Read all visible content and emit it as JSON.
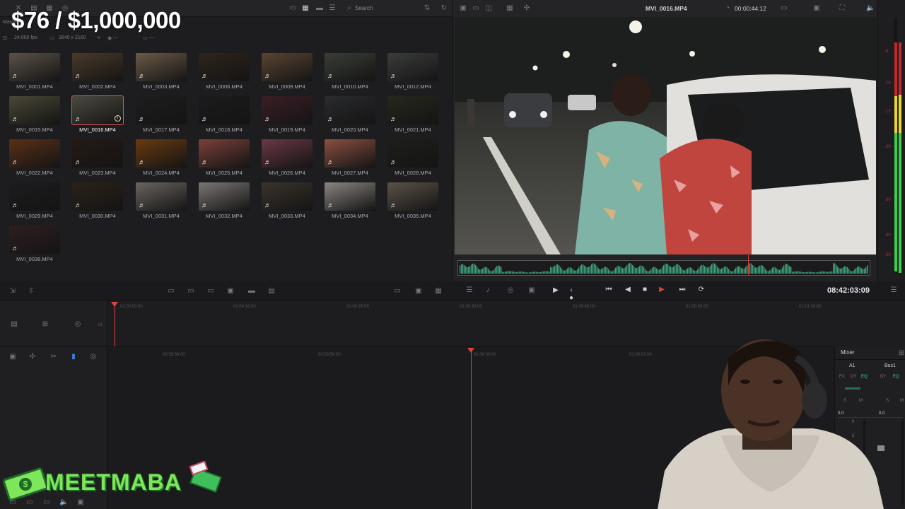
{
  "overlay": {
    "title": "$76 / $1,000,000"
  },
  "media_pool": {
    "header": "Master",
    "search_placeholder": "Search",
    "info": {
      "fps": "24.000 fps",
      "resolution": "3840 x 2160"
    },
    "clips": [
      {
        "name": "MVI_0001.MP4",
        "tone": "#5a5248"
      },
      {
        "name": "MVI_0002.MP4",
        "tone": "#4a3a2a"
      },
      {
        "name": "MVI_0003.MP4",
        "tone": "#6b5a48"
      },
      {
        "name": "MVI_0006.MP4",
        "tone": "#2e241c"
      },
      {
        "name": "MVI_0009.MP4",
        "tone": "#5a4430"
      },
      {
        "name": "MVI_0010.MP4",
        "tone": "#3a3e36"
      },
      {
        "name": "MVI_0012.MP4",
        "tone": "#3a3d3a"
      },
      {
        "name": "MVI_0015.MP4",
        "tone": "#4a4836"
      },
      {
        "name": "MVI_0016.MP4",
        "tone": "#4b4a40",
        "selected": true
      },
      {
        "name": "MVI_0017.MP4",
        "tone": "#1d1d1f"
      },
      {
        "name": "MVI_0018.MP4",
        "tone": "#1b1b1d"
      },
      {
        "name": "MVI_0019.MP4",
        "tone": "#3a1e26"
      },
      {
        "name": "MVI_0020.MP4",
        "tone": "#2a2b2d"
      },
      {
        "name": "MVI_0021.MP4",
        "tone": "#25281c"
      },
      {
        "name": "MVI_0022.MP4",
        "tone": "#5a3018"
      },
      {
        "name": "MVI_0023.MP4",
        "tone": "#251a14"
      },
      {
        "name": "MVI_0024.MP4",
        "tone": "#6a3a10"
      },
      {
        "name": "MVI_0025.MP4",
        "tone": "#7a4038"
      },
      {
        "name": "MVI_0026.MP4",
        "tone": "#6a3844"
      },
      {
        "name": "MVI_0027.MP4",
        "tone": "#8a5040"
      },
      {
        "name": "MVI_0028.MP4",
        "tone": "#1e1e1a"
      },
      {
        "name": "MVI_0029.MP4",
        "tone": "#1c1c1e"
      },
      {
        "name": "MVI_0030.MP4",
        "tone": "#2a2218"
      },
      {
        "name": "MVI_0031.MP4",
        "tone": "#6a6560"
      },
      {
        "name": "MVI_0032.MP4",
        "tone": "#7a7674"
      },
      {
        "name": "MVI_0033.MP4",
        "tone": "#3a342c"
      },
      {
        "name": "MVI_0034.MP4",
        "tone": "#8a8580"
      },
      {
        "name": "MVI_0035.MP4",
        "tone": "#5a5248"
      },
      {
        "name": "MVI_0036.MP4",
        "tone": "#2e1e20"
      }
    ]
  },
  "viewer": {
    "clip_name": "MVI_0016.MP4",
    "duration": "00:00:44:12",
    "timecode": "08:42:03:09"
  },
  "meter": {
    "labels": [
      "-5",
      "-10",
      "-15",
      "-20",
      "-30",
      "-40",
      "-50"
    ]
  },
  "mini_timeline": {
    "ruler": [
      "01:00:00:00",
      "01:00:16:00",
      "01:00:26:09",
      "01:00:30:00",
      "01:00:45:00",
      "01:00:50:00",
      "01:01:00:00"
    ],
    "track": "V1"
  },
  "main_timeline": {
    "ruler": [
      "00:59:56:00",
      "00:59:58:00",
      "01:00:00:00",
      "01:00:02:00"
    ]
  },
  "mixer": {
    "title": "Mixer",
    "channels": [
      {
        "name": "A1",
        "fx": "FX",
        "dy": "DY",
        "eq": "EQ",
        "value": "0.0"
      },
      {
        "name": "Bus1",
        "dy": "DY",
        "eq": "EQ",
        "value": "0.0"
      }
    ],
    "solo": "S",
    "mute": "M",
    "scale": [
      "0",
      "5",
      "10",
      "15"
    ]
  },
  "logo": {
    "text": "MEETMABA"
  },
  "colors": {
    "accent_red": "#e0403a",
    "meter_green": "#3ccf4e",
    "meter_yellow": "#e8d53a",
    "meter_red": "#c0282a",
    "waveform": "#3fa37a"
  }
}
